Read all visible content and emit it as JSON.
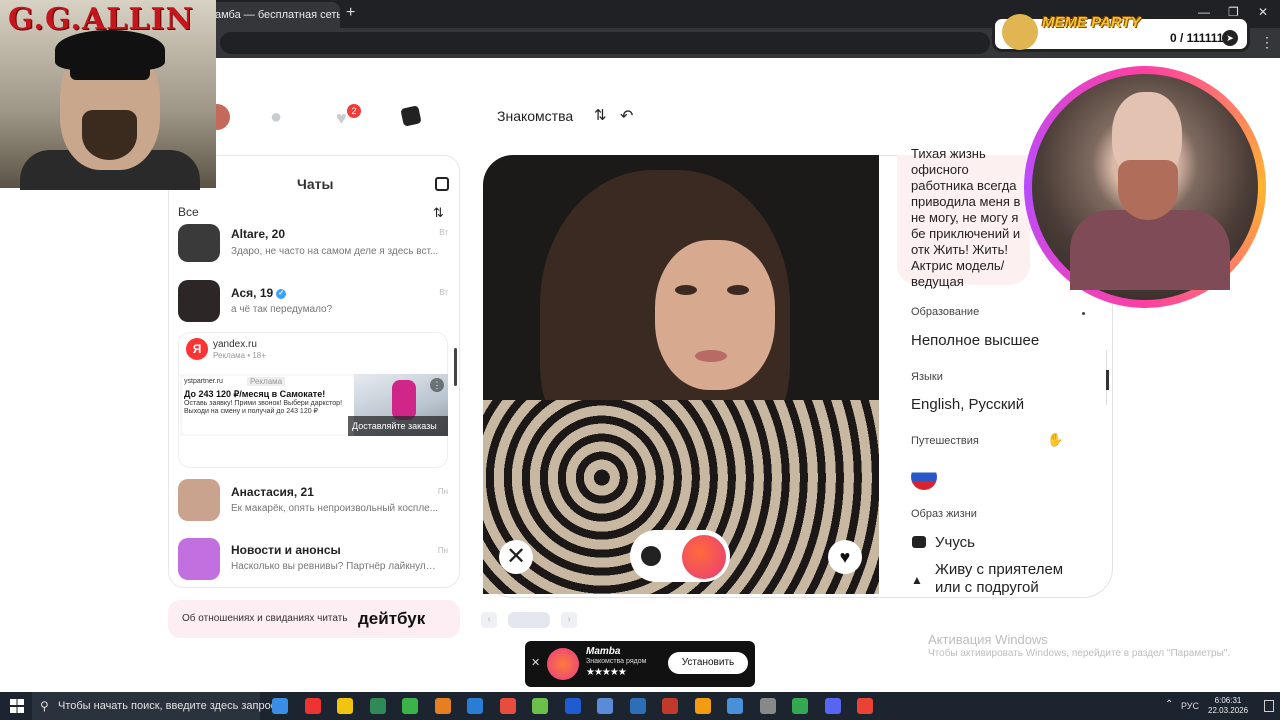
{
  "browser": {
    "tab_title": "амба — бесплатная сеть зна",
    "close": "×",
    "new_tab": "+",
    "minimize": "—",
    "maximize": "❐",
    "window_close": "✕",
    "menu": "⋮"
  },
  "overlay_left": {
    "title": "G.G.ALLIN"
  },
  "meme_party": {
    "title": "MEME PARTY",
    "count": "0 / 111111"
  },
  "header": {
    "nav_title": "Знакомства",
    "likes_badge": "2",
    "icons": [
      "avatar-icon",
      "search-icon",
      "likes-icon",
      "cards-icon",
      "filter-icon",
      "undo-icon"
    ]
  },
  "chats": {
    "title": "Чаты",
    "filter": "Все",
    "items": [
      {
        "name": "Altare, 20",
        "msg": "Здаро, не часто на самом деле я здесь вст...",
        "time": "Вт",
        "color": "#3a3a3a"
      },
      {
        "name": "Ася, 19",
        "msg": "а чё так передумало?",
        "time": "Вт",
        "color": "#2d2626",
        "verified": true
      },
      {
        "name": "Анастасия, 21",
        "msg": "Ек макарёк, опять непроизвольный косплe...",
        "time": "Пн",
        "color": "#c9a38d"
      },
      {
        "name": "Новости и анонсы",
        "msg": "Насколько вы ревнивы?     Партнёр лайкнул ч...",
        "time": "Пн",
        "color": "#c26fe0"
      }
    ]
  },
  "ad": {
    "domain": "yandex.ru",
    "sub": "Реклама • 18+",
    "logo": "Я",
    "partner": "ystpartner.ru",
    "partner_tag": "Реклама",
    "headline": "До 243 120 ₽/месяц в Самокате!",
    "body": "Оставь заявку! Прими звонок! Выбери даркстор! Выходи на смену и получай до 243 120 ₽",
    "cta": "Доставляйте заказы",
    "more": "⋮"
  },
  "promo": {
    "text": "Об отношениях и свиданиях читать",
    "logo": "дейтбук"
  },
  "profile": {
    "about": "Тихая жизнь офисного работника всегда приводила меня в не могу, не могу я бе приключений и отк Жить! Жить! Актрис модель/ведущая",
    "education_label": "Образование",
    "education": "Неполное высшее",
    "languages_label": "Языки",
    "languages": "English, Русский",
    "travel_label": "Путешествия",
    "lifestyle_label": "Образ жизни",
    "lifestyle": [
      "Учусь",
      "Живу с приятелем или с подругой"
    ]
  },
  "actions": {
    "dislike": "✕",
    "like": "♥"
  },
  "pager": {
    "prev": "‹",
    "next": "›"
  },
  "install": {
    "close": "✕",
    "name": "Mamba",
    "sub": "Знакомства рядом",
    "stars": "★★★★★",
    "button": "Установить"
  },
  "windows": {
    "activation_title": "Активация Windows",
    "activation_text": "Чтобы активировать Windows, перейдите в раздел \"Параметры\".",
    "search_placeholder": "Чтобы начать поиск, введите здесь запрос",
    "lang": "РУС",
    "time": "6:06:31",
    "date": "22.03.2026",
    "taskbar_colors": [
      "#3a8ee6",
      "#e33",
      "#f1c40f",
      "#2e8b57",
      "#3ab34a",
      "#e67e22",
      "#2b7cd3",
      "#e74c3c",
      "#6bc04b",
      "#1f5bd1",
      "#5b8bd6",
      "#2d6fb7",
      "#c0392b",
      "#f39c12",
      "#4a90d9",
      "#888",
      "#34a853",
      "#5865f2",
      "#ea4335"
    ]
  }
}
